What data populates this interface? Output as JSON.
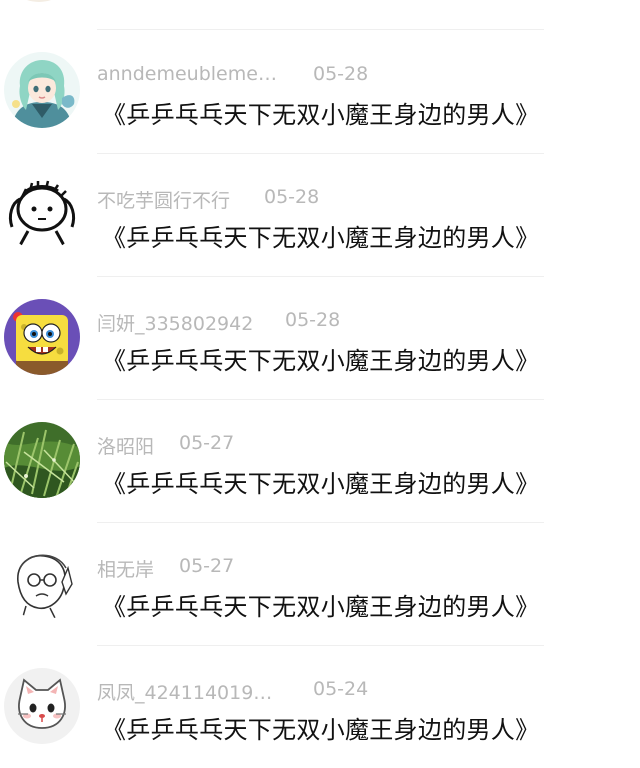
{
  "comments": [
    {
      "username": "anndemeubleme…",
      "date": "05-28",
      "text": "《乒乒乓乓天下无双小魔王身边的男人》",
      "avatar_icon": "anime-girl-avatar"
    },
    {
      "username": "不吃芋圆行不行",
      "date": "05-28",
      "text": "《乒乒乓乓天下无双小魔王身边的男人》",
      "avatar_icon": "doodle-face-avatar"
    },
    {
      "username": "闫妍_335802942",
      "date": "05-28",
      "text": "《乒乒乓乓天下无双小魔王身边的男人》",
      "avatar_icon": "spongebob-avatar"
    },
    {
      "username": "洛昭阳",
      "date": "05-27",
      "text": "《乒乒乓乓天下无双小魔王身边的男人》",
      "avatar_icon": "grass-photo-avatar"
    },
    {
      "username": "相无岸",
      "date": "05-27",
      "text": "《乒乒乓乓天下无双小魔王身边的男人》",
      "avatar_icon": "sketch-man-avatar"
    },
    {
      "username": "凤凤_424114019…",
      "date": "05-24",
      "text": "《乒乒乓乓天下无双小魔王身边的男人》",
      "avatar_icon": "white-cat-avatar"
    }
  ],
  "colors": {
    "username": "#b8b8b8",
    "date": "#b8b8b8",
    "text": "#111111",
    "divider": "#efefef",
    "background": "#ffffff"
  }
}
